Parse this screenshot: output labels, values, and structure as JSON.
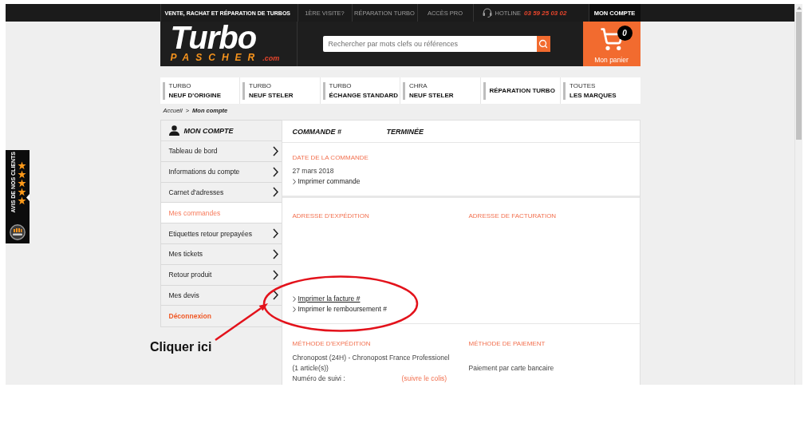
{
  "top_bar": {
    "tagline": "VENTE, RACHAT ET RÉPARATION DE TURBOS",
    "links": [
      "1ÈRE VISITE?",
      "RÉPARATION TURBO",
      "ACCÈS PRO"
    ],
    "hotline": {
      "label": "HOTLINE",
      "number": "03 59 25 03 02"
    },
    "account": "MON COMPTE"
  },
  "header": {
    "logo": {
      "wordmark": "Turbo",
      "subtitle": "PASCHER",
      "domain": ".com"
    },
    "search": {
      "placeholder": "Rechercher par mots clefs ou références"
    },
    "cart": {
      "count": "0",
      "label": "Mon panier"
    }
  },
  "category_nav": [
    {
      "label_top": "TURBO",
      "label_main": "NEUF D'ORIGINE"
    },
    {
      "label_top": "TURBO",
      "label_main": "NEUF STELER"
    },
    {
      "label_top": "TURBO",
      "label_main": "ÉCHANGE STANDARD"
    },
    {
      "label_top": "CHRA",
      "label_main": "NEUF STELER"
    },
    {
      "label_main": "RÉPARATION TURBO"
    },
    {
      "label_top": "TOUTES",
      "label_main": "LES MARQUES"
    }
  ],
  "breadcrumb": {
    "items": [
      {
        "label": "Accueil",
        "current": false
      },
      {
        "label": "Mon compte",
        "current": true
      }
    ],
    "separator": ">"
  },
  "sidebar": {
    "title": "MON COMPTE",
    "items": [
      {
        "label": "Tableau de bord",
        "kind": "link",
        "selected": false
      },
      {
        "label": "Informations du compte",
        "kind": "link",
        "selected": false
      },
      {
        "label": "Carnet d'adresses",
        "kind": "link",
        "selected": false
      },
      {
        "label": "Mes commandes",
        "kind": "link",
        "selected": true
      },
      {
        "label": "Etiquettes retour prepayées",
        "kind": "link",
        "selected": false
      },
      {
        "label": "Mes tickets",
        "kind": "link",
        "selected": false
      },
      {
        "label": "Retour produit",
        "kind": "link",
        "selected": false
      },
      {
        "label": "Mes devis",
        "kind": "link",
        "selected": false
      },
      {
        "label": "Déconnexion",
        "kind": "logout",
        "selected": false
      }
    ]
  },
  "order": {
    "title": "COMMANDE #",
    "status": "TERMINÉE",
    "date_section": {
      "heading": "DATE DE LA COMMANDE",
      "date": "27 mars 2018",
      "links": [
        {
          "label": "Imprimer commande",
          "underlined": false
        }
      ]
    },
    "address_section": {
      "shipping_heading": "ADRESSE D'EXPÉDITION",
      "billing_heading": "ADRESSE DE FACTURATION",
      "links": [
        {
          "label": "Imprimer la facture #",
          "underlined": true
        },
        {
          "label": "Imprimer le remboursement #",
          "underlined": false
        }
      ]
    },
    "method_section": {
      "shipping_heading": "MÉTHODE D'EXPÉDITION",
      "carrier": "Chronopost (24H) - Chronopost France Professionel",
      "item_count": "(1 article(s))",
      "tracking_label": "Numéro de suivi :",
      "tracking_link": "(suivre le colis)",
      "payment_heading": "MÉTHODE DE PAIEMENT",
      "payment_method": "Paiement par carte bancaire"
    }
  },
  "reviews_widget": {
    "label": "AVIS DE NOS CLIENTS"
  },
  "annotation": {
    "label": "Cliquer ici"
  }
}
